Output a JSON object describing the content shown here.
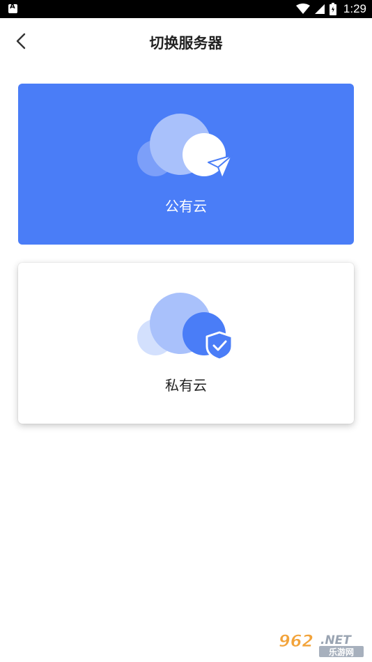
{
  "status_bar": {
    "time": "1:29",
    "icons": [
      "notification-a-icon",
      "wifi-icon",
      "cellular-signal-icon",
      "battery-icon"
    ]
  },
  "header": {
    "back_icon": "chevron-left-icon",
    "title": "切换服务器"
  },
  "options": [
    {
      "label": "公有云",
      "icon": "cloud-send-icon",
      "selected": true,
      "color": "#4a7df7"
    },
    {
      "label": "私有云",
      "icon": "cloud-shield-icon",
      "selected": false,
      "color": "#ffffff"
    }
  ],
  "watermark": {
    "brand": "962.NET",
    "subtitle": "乐游网"
  },
  "colors": {
    "accent": "#4a7df7",
    "light_cloud": "#a9c1fb",
    "pale_cloud": "#d3e0fd"
  }
}
